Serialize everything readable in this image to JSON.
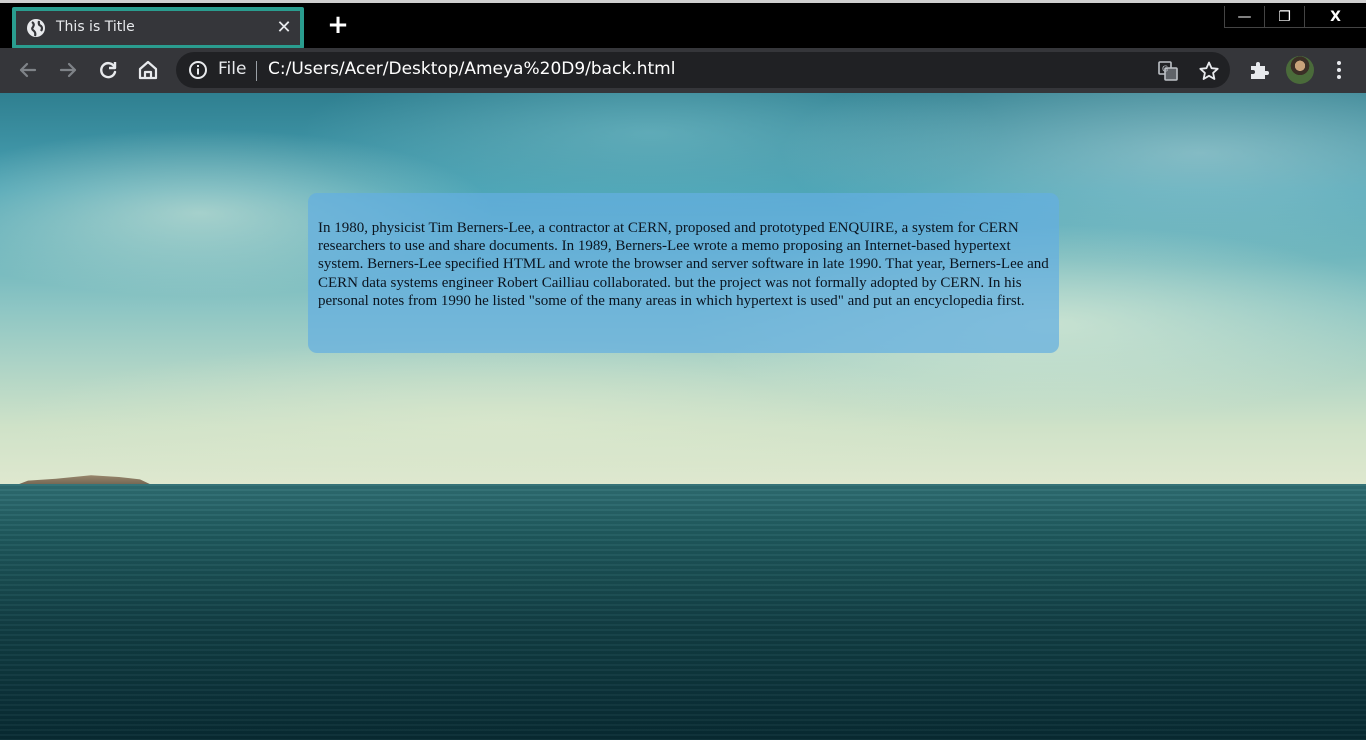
{
  "browser": {
    "tab": {
      "title": "This is Title",
      "favicon": "globe-icon",
      "close": "✕"
    },
    "new_tab": "+",
    "window_controls": {
      "minimize": "—",
      "restore": "❐",
      "close": "X"
    },
    "toolbar": {
      "back": "arrow-left-icon",
      "forward": "arrow-right-icon",
      "reload": "reload-icon",
      "home": "home-icon",
      "scheme_label": "File",
      "url": "C:/Users/Acer/Desktop/Ameya%20D9/back.html",
      "translate": "translate-icon",
      "bookmark": "star-icon",
      "extensions": "puzzle-icon",
      "menu": "kebab-menu-icon"
    }
  },
  "page": {
    "paragraph": "In 1980, physicist Tim Berners-Lee, a contractor at CERN, proposed and prototyped ENQUIRE, a system for CERN researchers to use and share documents. In 1989, Berners-Lee wrote a memo proposing an Internet-based hypertext system. Berners-Lee specified HTML and wrote the browser and server software in late 1990. That year, Berners-Lee and CERN data systems engineer Robert Cailliau collaborated. but the project was not formally adopted by CERN. In his personal notes from 1990 he listed \"some of the many areas in which hypertext is used\" and put an encyclopedia first."
  },
  "colors": {
    "tab_highlight": "#2a9d8f",
    "toolbar_bg": "#35363a",
    "textbox_bg": "rgba(100,175,225,0.72)"
  }
}
